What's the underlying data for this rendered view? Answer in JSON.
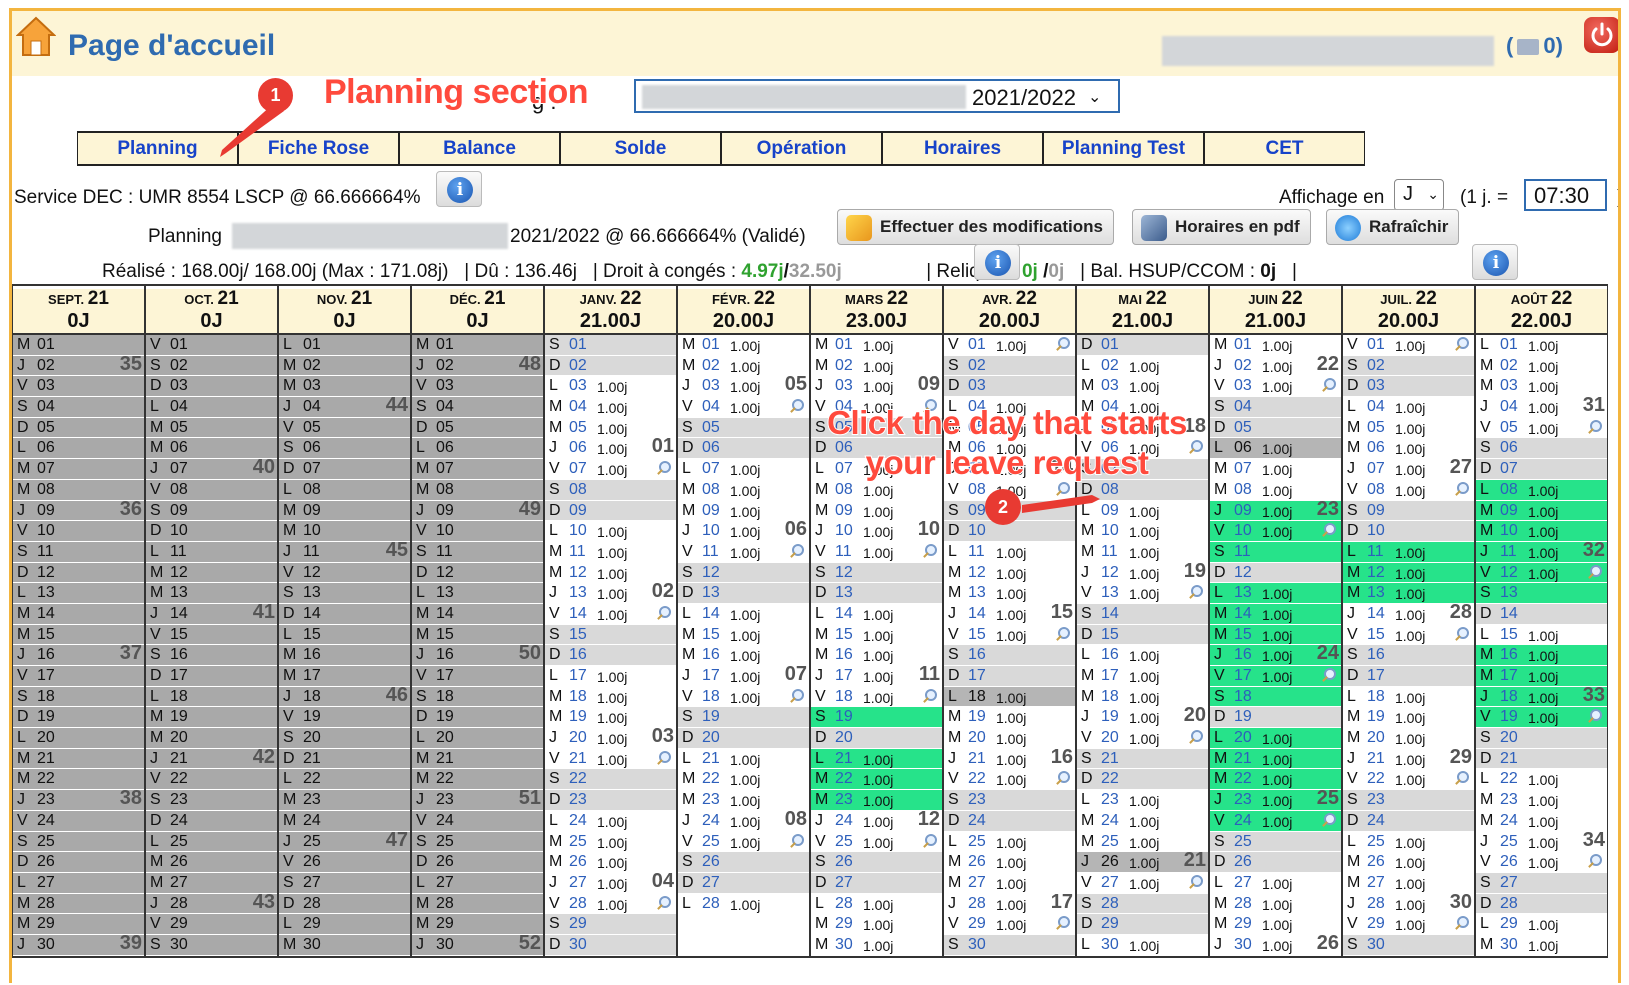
{
  "header": {
    "title": "Page d'accueil",
    "mail_count_prefix": "(",
    "mail_count": "0)"
  },
  "agent": {
    "label": "g :",
    "year": "2021/2022"
  },
  "annotations": {
    "callout1_num": "1",
    "callout1_text": "Planning section",
    "callout2_num": "2",
    "callout2_text": "Click the day that starts your leave request"
  },
  "tabs": [
    "Planning",
    "Fiche Rose",
    "Balance",
    "Solde",
    "Opération",
    "Horaires",
    "Planning Test",
    "CET"
  ],
  "service": {
    "text": "Service DEC : UMR 8554 LSCP @ 66.666664%"
  },
  "affichage": {
    "label": "Affichage en",
    "unit": "J",
    "day_label": "(1 j. =",
    "day_value": "07:30",
    "close_paren": ")"
  },
  "planning": {
    "label": "Planning",
    "value": "2021/2022 @ 66.666664% (Validé)"
  },
  "buttons": {
    "modify": "Effectuer des modifications",
    "pdf": "Horaires en pdf",
    "refresh": "Rafraîchir"
  },
  "stats": {
    "realise": "Réalisé : 168.00j/ 168.00j (Max : 171.08j)",
    "du": "| Dû : 136.46j",
    "droit_label": "| Droit à congés :",
    "droit_a": "4.97j",
    "droit_sep": "/",
    "droit_b": "32.50j",
    "reliquat_label": "| Reliquat :",
    "reliquat_a": "0j",
    "reliquat_sep": "/",
    "reliquat_b": "0j",
    "bal_label": "| Bal. HSUP/CCOM :",
    "bal_val": "0j",
    "end": "|"
  },
  "calendar": {
    "months": [
      {
        "abbr": "SEPT.",
        "yr": "21",
        "total": "0J",
        "first": "M",
        "days": 30,
        "wkStart": 35,
        "weekNumAt": [
          "02",
          35,
          "09",
          36,
          "16",
          37,
          "23",
          38,
          "30",
          39
        ],
        "style": "grey"
      },
      {
        "abbr": "OCT.",
        "yr": "21",
        "total": "0J",
        "style": "grey"
      },
      {
        "abbr": "NOV.",
        "yr": "21",
        "total": "0J",
        "style": "grey"
      },
      {
        "abbr": "DÉC.",
        "yr": "21",
        "total": "0J",
        "style": "grey"
      },
      {
        "abbr": "JANV.",
        "yr": "22",
        "total": "21.00J",
        "style": "work"
      },
      {
        "abbr": "FÉVR.",
        "yr": "22",
        "total": "20.00J",
        "style": "work"
      },
      {
        "abbr": "MARS",
        "yr": "22",
        "total": "23.00J",
        "style": "work"
      },
      {
        "abbr": "AVR.",
        "yr": "22",
        "total": "20.00J",
        "style": "work"
      },
      {
        "abbr": "MAI",
        "yr": "22",
        "total": "21.00J",
        "style": "work"
      },
      {
        "abbr": "JUIN",
        "yr": "22",
        "total": "21.00J",
        "style": "work"
      },
      {
        "abbr": "JUIL.",
        "yr": "22",
        "total": "20.00J",
        "style": "work"
      },
      {
        "abbr": "AOÛT",
        "yr": "22",
        "total": "22.00J",
        "style": "work"
      }
    ],
    "day_value": "1.00j",
    "colors": {
      "grey": "#a9a9a9",
      "weekend": "#d9d9d9",
      "leave": "#26e38a",
      "header": "#fdf5d6",
      "accent": "#2f6bb0"
    }
  }
}
